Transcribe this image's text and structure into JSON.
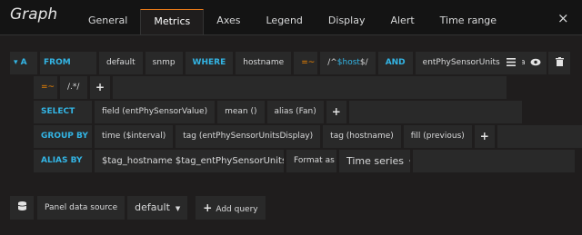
{
  "panel": {
    "title": "Graph"
  },
  "tabs": [
    {
      "label": "General"
    },
    {
      "label": "Metrics"
    },
    {
      "label": "Axes"
    },
    {
      "label": "Legend"
    },
    {
      "label": "Display"
    },
    {
      "label": "Alert"
    },
    {
      "label": "Time range"
    }
  ],
  "close_icon": "×",
  "query": {
    "ref": "▾ A",
    "from_kw": "FROM",
    "retention": "default",
    "measurement": "snmp",
    "where_kw": "WHERE",
    "tag_key": "hostname",
    "operator": "=~",
    "regex_prefix": "/^",
    "regex_var": "$host",
    "regex_suffix": "$/",
    "and_kw": "AND",
    "tag_key2": "entPhySensorUnitsDisplay",
    "operator2": "=~",
    "regex2": "/.*/",
    "plus": "+",
    "select_kw": "SELECT",
    "select_parts": [
      "field (entPhySensorValue)",
      "mean ()",
      "alias (Fan)"
    ],
    "groupby_kw": "GROUP BY",
    "groupby_parts": [
      "time ($interval)",
      "tag (entPhySensorUnitsDisplay)",
      "tag (hostname)",
      "fill (previous)"
    ],
    "alias_kw": "ALIAS BY",
    "alias_value": "$tag_hostname $tag_entPhySensorUnitsDi",
    "format_label": "Format as",
    "format_value": "Time series"
  },
  "row_actions": {
    "menu_icon": "menu-icon",
    "eye_icon": "eye-icon",
    "trash_icon": "trash-icon"
  },
  "footer": {
    "datasource_label": "Panel data source",
    "datasource_value": "default",
    "add_query_label": "Add query"
  }
}
